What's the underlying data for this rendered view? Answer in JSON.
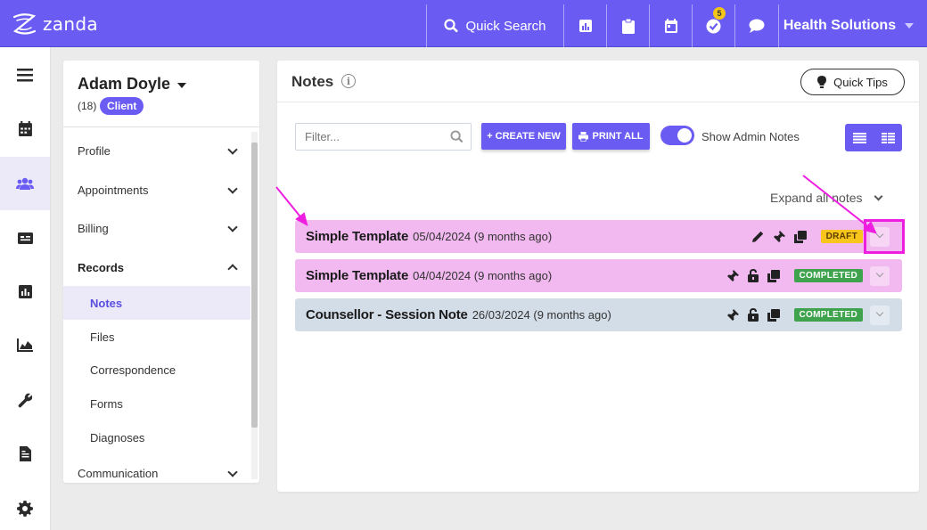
{
  "brand": {
    "name": "zanda"
  },
  "topbar": {
    "quick_search": "Quick Search",
    "org_name": "Health Solutions",
    "tasks_badge": "5"
  },
  "client": {
    "name": "Adam Doyle",
    "count": "(18)",
    "type_badge": "Client"
  },
  "sidebar": {
    "items": [
      {
        "label": "Profile"
      },
      {
        "label": "Appointments"
      },
      {
        "label": "Billing"
      },
      {
        "label": "Records"
      },
      {
        "label": "Notes"
      },
      {
        "label": "Files"
      },
      {
        "label": "Correspondence"
      },
      {
        "label": "Forms"
      },
      {
        "label": "Diagnoses"
      },
      {
        "label": "Communication"
      }
    ]
  },
  "notes": {
    "title": "Notes",
    "quick_tips": "Quick Tips",
    "filter_placeholder": "Filter...",
    "create_new": "+ CREATE NEW",
    "print_all": "PRINT ALL",
    "show_admin_notes": "Show Admin Notes",
    "expand_all": "Expand all notes",
    "rows": [
      {
        "title": "Simple Template",
        "date": "05/04/2024 (9 months ago)",
        "status": "DRAFT"
      },
      {
        "title": "Simple Template",
        "date": "04/04/2024 (9 months ago)",
        "status": "COMPLETED"
      },
      {
        "title": "Counsellor - Session Note",
        "date": "26/03/2024 (9 months ago)",
        "status": "COMPLETED"
      }
    ]
  },
  "colors": {
    "brand": "#6a5cf3",
    "row_pink": "#f1b9ef",
    "row_gray": "#d3dde8",
    "draft": "#f7c51b",
    "completed": "#3fa34d",
    "annotation": "#ee1ee0"
  }
}
